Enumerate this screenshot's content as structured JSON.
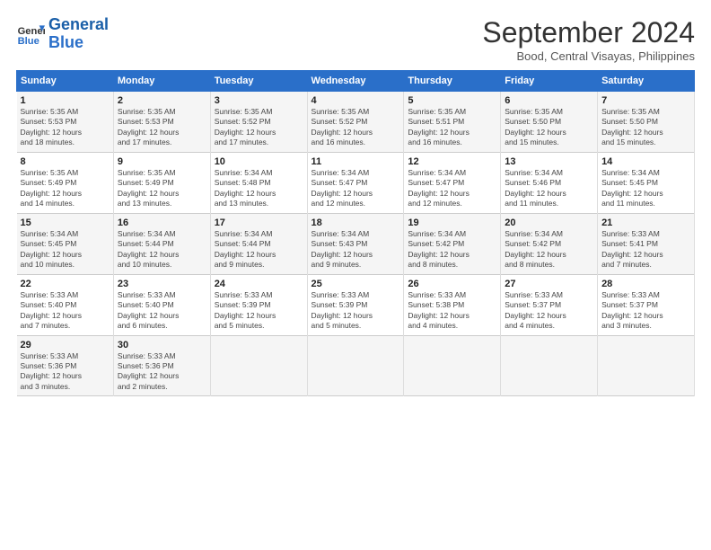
{
  "logo": {
    "line1": "General",
    "line2": "Blue"
  },
  "title": "September 2024",
  "subtitle": "Bood, Central Visayas, Philippines",
  "header": {
    "days": [
      "Sunday",
      "Monday",
      "Tuesday",
      "Wednesday",
      "Thursday",
      "Friday",
      "Saturday"
    ]
  },
  "weeks": [
    [
      {
        "day": "1",
        "info": "Sunrise: 5:35 AM\nSunset: 5:53 PM\nDaylight: 12 hours\nand 18 minutes."
      },
      {
        "day": "2",
        "info": "Sunrise: 5:35 AM\nSunset: 5:53 PM\nDaylight: 12 hours\nand 17 minutes."
      },
      {
        "day": "3",
        "info": "Sunrise: 5:35 AM\nSunset: 5:52 PM\nDaylight: 12 hours\nand 17 minutes."
      },
      {
        "day": "4",
        "info": "Sunrise: 5:35 AM\nSunset: 5:52 PM\nDaylight: 12 hours\nand 16 minutes."
      },
      {
        "day": "5",
        "info": "Sunrise: 5:35 AM\nSunset: 5:51 PM\nDaylight: 12 hours\nand 16 minutes."
      },
      {
        "day": "6",
        "info": "Sunrise: 5:35 AM\nSunset: 5:50 PM\nDaylight: 12 hours\nand 15 minutes."
      },
      {
        "day": "7",
        "info": "Sunrise: 5:35 AM\nSunset: 5:50 PM\nDaylight: 12 hours\nand 15 minutes."
      }
    ],
    [
      {
        "day": "8",
        "info": "Sunrise: 5:35 AM\nSunset: 5:49 PM\nDaylight: 12 hours\nand 14 minutes."
      },
      {
        "day": "9",
        "info": "Sunrise: 5:35 AM\nSunset: 5:49 PM\nDaylight: 12 hours\nand 13 minutes."
      },
      {
        "day": "10",
        "info": "Sunrise: 5:34 AM\nSunset: 5:48 PM\nDaylight: 12 hours\nand 13 minutes."
      },
      {
        "day": "11",
        "info": "Sunrise: 5:34 AM\nSunset: 5:47 PM\nDaylight: 12 hours\nand 12 minutes."
      },
      {
        "day": "12",
        "info": "Sunrise: 5:34 AM\nSunset: 5:47 PM\nDaylight: 12 hours\nand 12 minutes."
      },
      {
        "day": "13",
        "info": "Sunrise: 5:34 AM\nSunset: 5:46 PM\nDaylight: 12 hours\nand 11 minutes."
      },
      {
        "day": "14",
        "info": "Sunrise: 5:34 AM\nSunset: 5:45 PM\nDaylight: 12 hours\nand 11 minutes."
      }
    ],
    [
      {
        "day": "15",
        "info": "Sunrise: 5:34 AM\nSunset: 5:45 PM\nDaylight: 12 hours\nand 10 minutes."
      },
      {
        "day": "16",
        "info": "Sunrise: 5:34 AM\nSunset: 5:44 PM\nDaylight: 12 hours\nand 10 minutes."
      },
      {
        "day": "17",
        "info": "Sunrise: 5:34 AM\nSunset: 5:44 PM\nDaylight: 12 hours\nand 9 minutes."
      },
      {
        "day": "18",
        "info": "Sunrise: 5:34 AM\nSunset: 5:43 PM\nDaylight: 12 hours\nand 9 minutes."
      },
      {
        "day": "19",
        "info": "Sunrise: 5:34 AM\nSunset: 5:42 PM\nDaylight: 12 hours\nand 8 minutes."
      },
      {
        "day": "20",
        "info": "Sunrise: 5:34 AM\nSunset: 5:42 PM\nDaylight: 12 hours\nand 8 minutes."
      },
      {
        "day": "21",
        "info": "Sunrise: 5:33 AM\nSunset: 5:41 PM\nDaylight: 12 hours\nand 7 minutes."
      }
    ],
    [
      {
        "day": "22",
        "info": "Sunrise: 5:33 AM\nSunset: 5:40 PM\nDaylight: 12 hours\nand 7 minutes."
      },
      {
        "day": "23",
        "info": "Sunrise: 5:33 AM\nSunset: 5:40 PM\nDaylight: 12 hours\nand 6 minutes."
      },
      {
        "day": "24",
        "info": "Sunrise: 5:33 AM\nSunset: 5:39 PM\nDaylight: 12 hours\nand 5 minutes."
      },
      {
        "day": "25",
        "info": "Sunrise: 5:33 AM\nSunset: 5:39 PM\nDaylight: 12 hours\nand 5 minutes."
      },
      {
        "day": "26",
        "info": "Sunrise: 5:33 AM\nSunset: 5:38 PM\nDaylight: 12 hours\nand 4 minutes."
      },
      {
        "day": "27",
        "info": "Sunrise: 5:33 AM\nSunset: 5:37 PM\nDaylight: 12 hours\nand 4 minutes."
      },
      {
        "day": "28",
        "info": "Sunrise: 5:33 AM\nSunset: 5:37 PM\nDaylight: 12 hours\nand 3 minutes."
      }
    ],
    [
      {
        "day": "29",
        "info": "Sunrise: 5:33 AM\nSunset: 5:36 PM\nDaylight: 12 hours\nand 3 minutes."
      },
      {
        "day": "30",
        "info": "Sunrise: 5:33 AM\nSunset: 5:36 PM\nDaylight: 12 hours\nand 2 minutes."
      },
      {
        "day": "",
        "info": ""
      },
      {
        "day": "",
        "info": ""
      },
      {
        "day": "",
        "info": ""
      },
      {
        "day": "",
        "info": ""
      },
      {
        "day": "",
        "info": ""
      }
    ]
  ]
}
